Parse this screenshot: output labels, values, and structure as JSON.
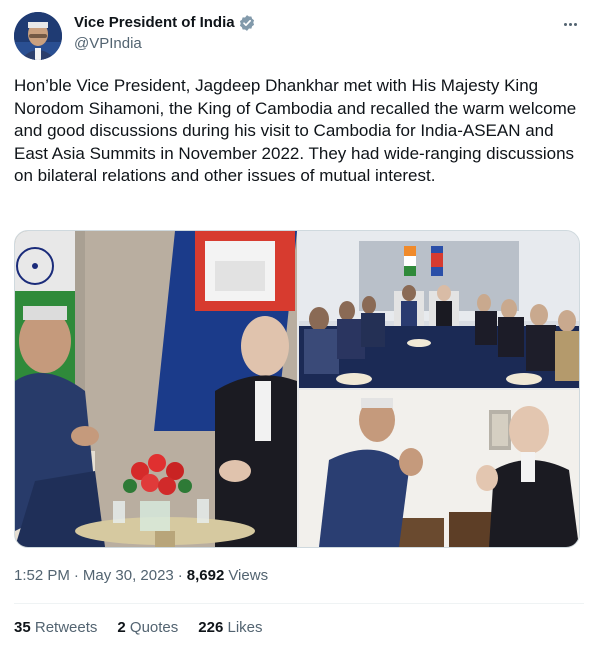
{
  "author": {
    "display_name": "Vice President of India",
    "handle": "@VPIndia",
    "verified_color": "#829aab"
  },
  "tweet": {
    "text": "Hon’ble Vice President, Jagdeep Dhankhar met with His Majesty King Norodom Sihamoni, the King of Cambodia and recalled the warm welcome and good discussions during his visit to Cambodia for India-ASEAN and East Asia Summits in November 2022. They had wide-ranging discussions on bilateral relations and other issues of mutual interest."
  },
  "meta": {
    "time": "1:52 PM",
    "date": "May 30, 2023",
    "separator": "·",
    "views_count": "8,692",
    "views_label": "Views"
  },
  "stats": {
    "retweets_count": "35",
    "retweets_label": "Retweets",
    "quotes_count": "2",
    "quotes_label": "Quotes",
    "likes_count": "226",
    "likes_label": "Likes"
  },
  "icons": {
    "more": "more-horizontal-icon",
    "verified": "verified-badge-icon"
  },
  "colors": {
    "text_primary": "#0f1419",
    "text_secondary": "#536471",
    "border": "#cfd9de"
  }
}
